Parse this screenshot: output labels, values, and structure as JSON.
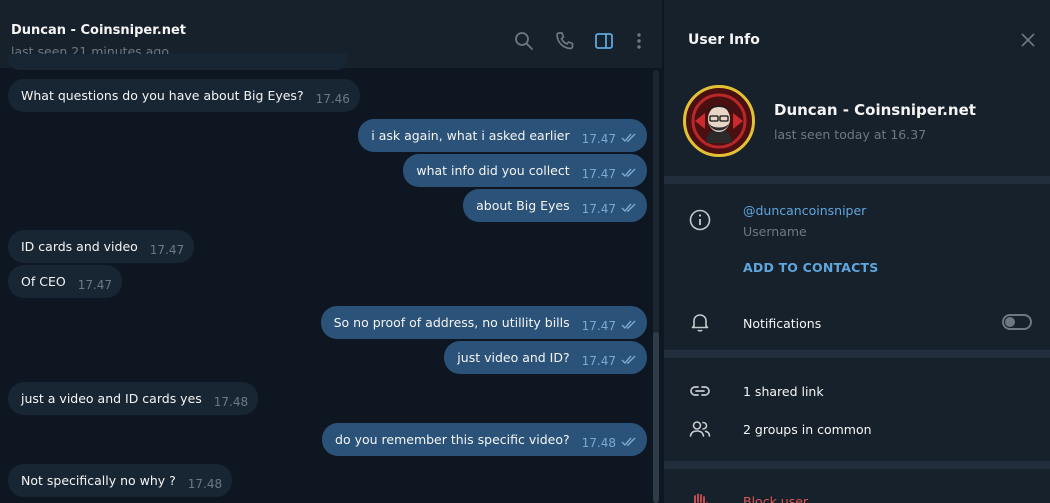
{
  "chat": {
    "title": "Duncan - Coinsniper.net",
    "status": "last seen 21 minutes ago",
    "header_icons": [
      "search-icon",
      "phone-icon",
      "sidebar-toggle-icon",
      "more-vertical-icon"
    ],
    "messages": [
      {
        "dir": "in",
        "text": "What questions do you have about Big Eyes?",
        "time": "17.46"
      },
      {
        "dir": "out",
        "text": "i ask again, what i asked earlier",
        "time": "17.47",
        "read": true
      },
      {
        "dir": "out",
        "text": "what info did you collect",
        "time": "17.47",
        "read": true
      },
      {
        "dir": "out",
        "text": "about Big Eyes",
        "time": "17.47",
        "read": true
      },
      {
        "dir": "in",
        "text": "ID cards and video",
        "time": "17.47"
      },
      {
        "dir": "in",
        "text": "Of CEO",
        "time": "17.47"
      },
      {
        "dir": "out",
        "text": "So no proof of address, no utillity bills",
        "time": "17.47",
        "read": true
      },
      {
        "dir": "out",
        "text": "just video and ID?",
        "time": "17.47",
        "read": true
      },
      {
        "dir": "in",
        "text": "just a video and ID cards yes",
        "time": "17.48"
      },
      {
        "dir": "out",
        "text": "do you remember this specific video?",
        "time": "17.48",
        "read": true
      },
      {
        "dir": "in",
        "text": "Not specifically no why ?",
        "time": "17.48"
      }
    ]
  },
  "user_info": {
    "title": "User Info",
    "name": "Duncan - Coinsniper.net",
    "status": "last seen today at 16.37",
    "username": "@duncancoinsniper",
    "username_caption": "Username",
    "add_contacts": "ADD TO CONTACTS",
    "notifications_label": "Notifications",
    "notifications_on": false,
    "shared_links": "1 shared link",
    "groups_in_common": "2 groups in common",
    "block_user": "Block user"
  },
  "colors": {
    "background": "#0e1621",
    "panel": "#17212b",
    "incoming_bubble": "#182533",
    "outgoing_bubble": "#2b5278",
    "link": "#5fa6dd",
    "muted": "#6d7883",
    "danger": "#e05555"
  }
}
